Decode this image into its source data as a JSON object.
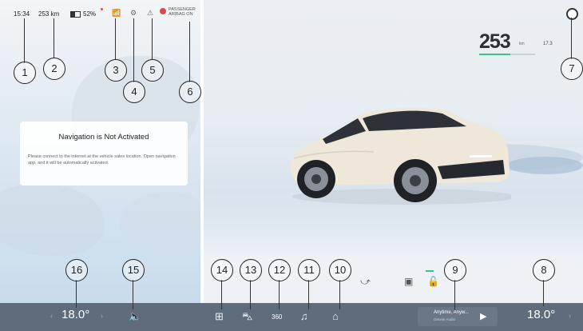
{
  "status_bar": {
    "time": "15:34",
    "range": "253 km",
    "battery": "52%",
    "airbag_line1": "PASSENGER",
    "airbag_line2": "AIRBAG ON"
  },
  "navigation": {
    "title": "Navigation is Not Activated",
    "body": "Please connect to the internet at the vehicle sales location. Open navigation app, and it will be automatically activated."
  },
  "dashboard": {
    "speed": "253",
    "speed_unit": "km",
    "secondary_value": "17.3"
  },
  "bottom_bar": {
    "left_temp": "18.0°",
    "right_temp": "18.0°",
    "camera_label": "360",
    "media_title": "Anytime, Anyw...",
    "media_subtitle": "Gennie Audio"
  },
  "callouts": [
    "1",
    "2",
    "3",
    "4",
    "5",
    "6",
    "7",
    "8",
    "9",
    "10",
    "11",
    "12",
    "13",
    "14",
    "15",
    "16"
  ],
  "icons": {
    "signal": "signal-icon",
    "gear": "gear-icon",
    "seatbelt": "seatbelt-icon",
    "airbag": "airbag-icon",
    "profile": "profile-icon",
    "apps": "apps-icon",
    "car": "car-icon",
    "camera": "camera-360-icon",
    "music": "music-icon",
    "vehicle": "vehicle-control-icon",
    "media_play": "play-icon",
    "volume": "volume-icon"
  },
  "colors": {
    "accent": "#3bbf8b",
    "bottom_bar": "#5e6c7c",
    "airbag_red": "#d94a4a"
  },
  "speed_progress": 0.55
}
